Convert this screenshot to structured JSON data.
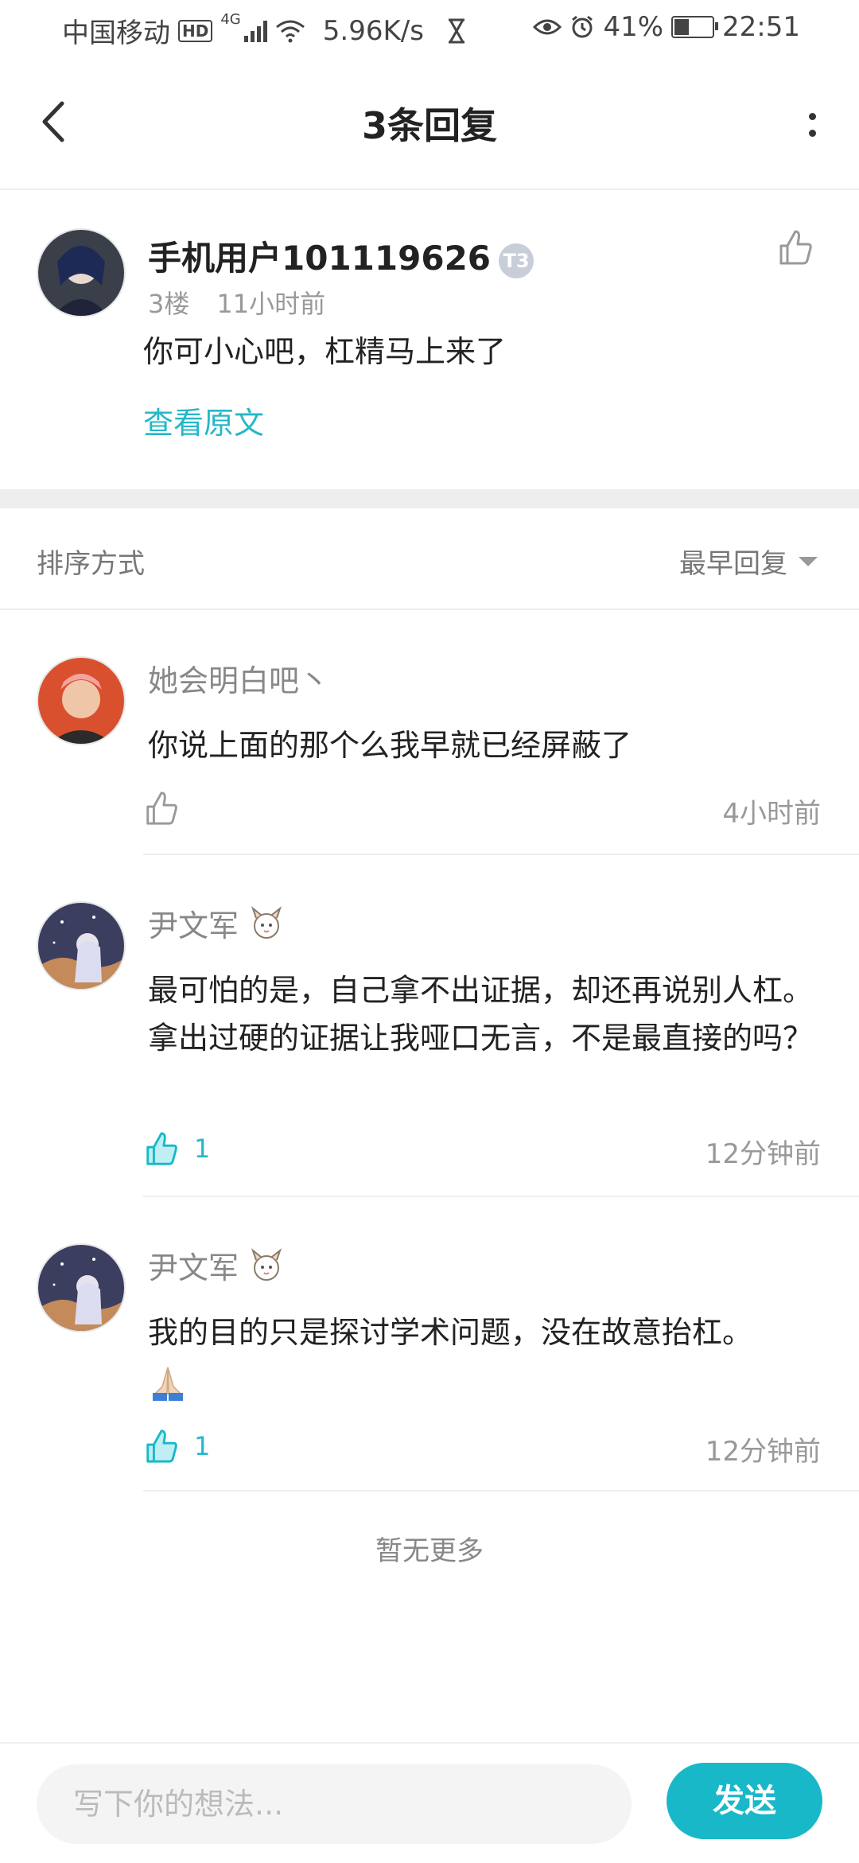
{
  "status_bar": {
    "carrier": "中国移动",
    "hd": "HD",
    "network": "4G",
    "speed": "5.96K/s",
    "battery": "41%",
    "time": "22:51"
  },
  "header": {
    "title": "3条回复"
  },
  "post": {
    "username": "手机用户101119626",
    "level_badge": "T3",
    "floor": "3楼",
    "time": "11小时前",
    "content": "你可小心吧，杠精马上来了",
    "view_original": "查看原文"
  },
  "sort": {
    "label": "排序方式",
    "value": "最早回复"
  },
  "replies": [
    {
      "username": "她会明白吧丶",
      "content": "你说上面的那个么我早就已经屏蔽了",
      "likes": "",
      "liked": false,
      "time": "4小时前"
    },
    {
      "username": "尹文军",
      "content": "最可怕的是，自己拿不出证据，却还再说别人杠。拿出过硬的证据让我哑口无言，不是最直接的吗？",
      "likes": "1",
      "liked": true,
      "time": "12分钟前"
    },
    {
      "username": "尹文军",
      "content": "我的目的只是探讨学术问题，没在故意抬杠。",
      "likes": "1",
      "liked": true,
      "time": "12分钟前"
    }
  ],
  "footer": {
    "no_more": "暂无更多"
  },
  "input": {
    "placeholder": "写下你的想法..."
  },
  "send_label": "发送",
  "colors": {
    "accent": "#18b8c9",
    "link": "#26b7c7"
  }
}
